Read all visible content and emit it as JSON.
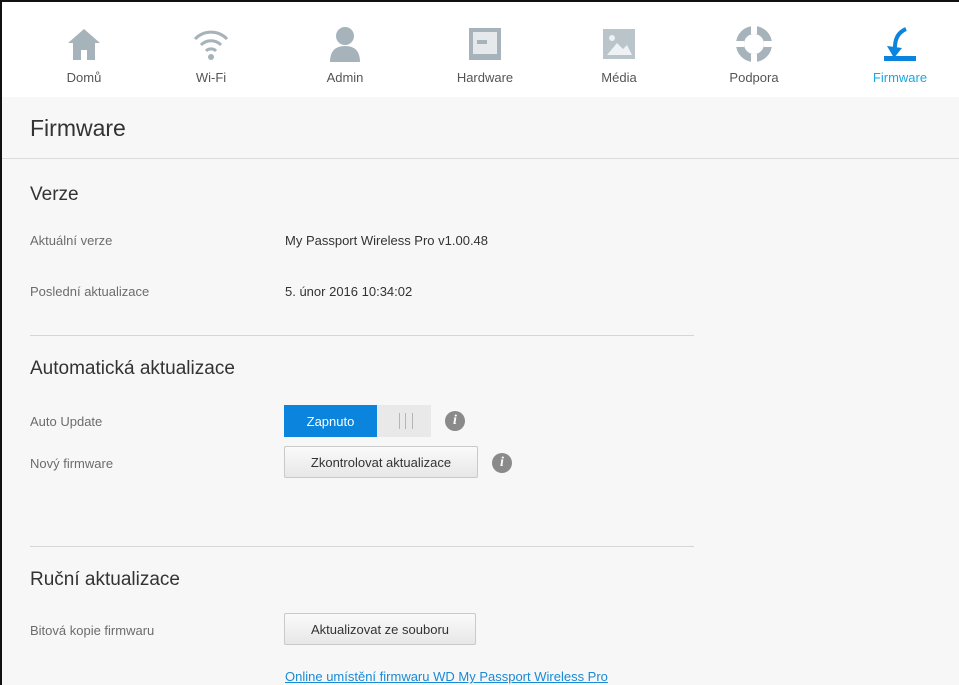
{
  "nav": {
    "items": [
      {
        "label": "Domů",
        "icon": "home-icon"
      },
      {
        "label": "Wi-Fi",
        "icon": "wifi-icon"
      },
      {
        "label": "Admin",
        "icon": "user-icon"
      },
      {
        "label": "Hardware",
        "icon": "hardware-icon"
      },
      {
        "label": "Média",
        "icon": "media-icon"
      },
      {
        "label": "Podpora",
        "icon": "support-icon"
      },
      {
        "label": "Firmware",
        "icon": "firmware-icon"
      }
    ],
    "active": "Firmware",
    "accent_color": "#1aa7e0",
    "icon_color": "#a6b3bb"
  },
  "page": {
    "title": "Firmware"
  },
  "version": {
    "title": "Verze",
    "current_label": "Aktuální verze",
    "current_value": "My Passport Wireless Pro v1.00.48",
    "last_label": "Poslední aktualizace",
    "last_value": "5. únor 2016 10:34:02"
  },
  "auto": {
    "title": "Automatická aktualizace",
    "auto_update_label": "Auto Update",
    "toggle_on_label": "Zapnuto",
    "new_fw_label": "Nový firmware",
    "check_button": "Zkontrolovat aktualizace",
    "toggle_color": "#0a84dc"
  },
  "manual": {
    "title": "Ruční aktualizace",
    "image_label": "Bitová kopie firmwaru",
    "update_button": "Aktualizovat ze souboru",
    "online_link": "Online umístění firmwaru WD My Passport Wireless Pro"
  }
}
